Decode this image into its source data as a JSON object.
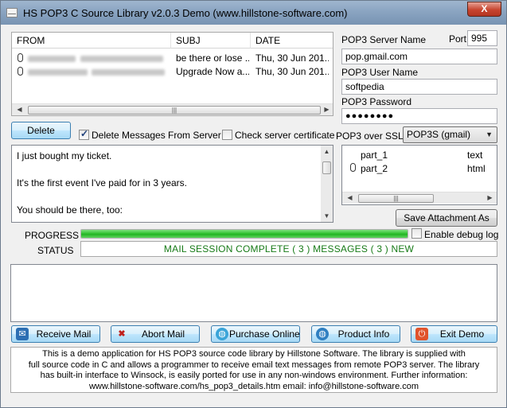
{
  "window": {
    "title": "HS POP3 C Source Library v2.0.3  Demo (www.hillstone-software.com)",
    "close_label": "X"
  },
  "mail_list": {
    "columns": [
      "FROM",
      "SUBJ",
      "DATE"
    ],
    "rows": [
      {
        "subj": "be there or lose ...",
        "date": "Thu, 30 Jun 201..."
      },
      {
        "subj": "Upgrade Now a...",
        "date": "Thu, 30 Jun 201..."
      }
    ]
  },
  "server": {
    "server_label": "POP3 Server Name",
    "port_label": "Port",
    "port_value": "995",
    "server_value": "pop.gmail.com",
    "user_label": "POP3 User Name",
    "user_value": "softpedia",
    "password_label": "POP3 Password",
    "password_value": "●●●●●●●●",
    "ssl_label": "POP3 over SSL:",
    "ssl_value": "POP3S (gmail)"
  },
  "actions": {
    "delete_label": "Delete",
    "delete_from_server_label": "Delete Messages From Server",
    "delete_from_server_checked": true,
    "check_cert_label": "Check server certificate",
    "check_cert_checked": false
  },
  "message_body": {
    "lines": [
      "I just bought my ticket.",
      "It's the first event I've paid for in 3 years.",
      "You should be there, too:"
    ]
  },
  "attachments": {
    "items": [
      {
        "name": "part_1",
        "type": "text",
        "icon": "none"
      },
      {
        "name": "part_2",
        "type": "html",
        "icon": "paperclip-icon"
      }
    ],
    "save_label": "Save Attachment As"
  },
  "progress": {
    "label": "PROGRESS",
    "value_fraction": 1.0,
    "debug_label": "Enable debug log",
    "debug_checked": false
  },
  "status": {
    "label": "STATUS",
    "text": "MAIL SESSION COMPLETE ( 3 ) MESSAGES ( 3 ) NEW"
  },
  "buttons": {
    "receive": "Receive Mail",
    "abort": "Abort Mail",
    "purchase": "Purchase Online",
    "product": "Product Info",
    "exit": "Exit Demo"
  },
  "info_lines": [
    "This is a demo application for HS POP3 source code library by Hillstone Software. The library is supplied with",
    "full source code in C and allows a programmer to receive email text messages from remote POP3 server. The library",
    "has built-in interface to Winsock, is easily ported for use in any non-windows environment. Further information:",
    "www.hillstone-software.com/hs_pop3_details.htm email: info@hillstone-software.com"
  ],
  "colors": {
    "status_text": "#167a16",
    "progress_fill": "#22b322",
    "titlebar": "#8aa4c1"
  }
}
